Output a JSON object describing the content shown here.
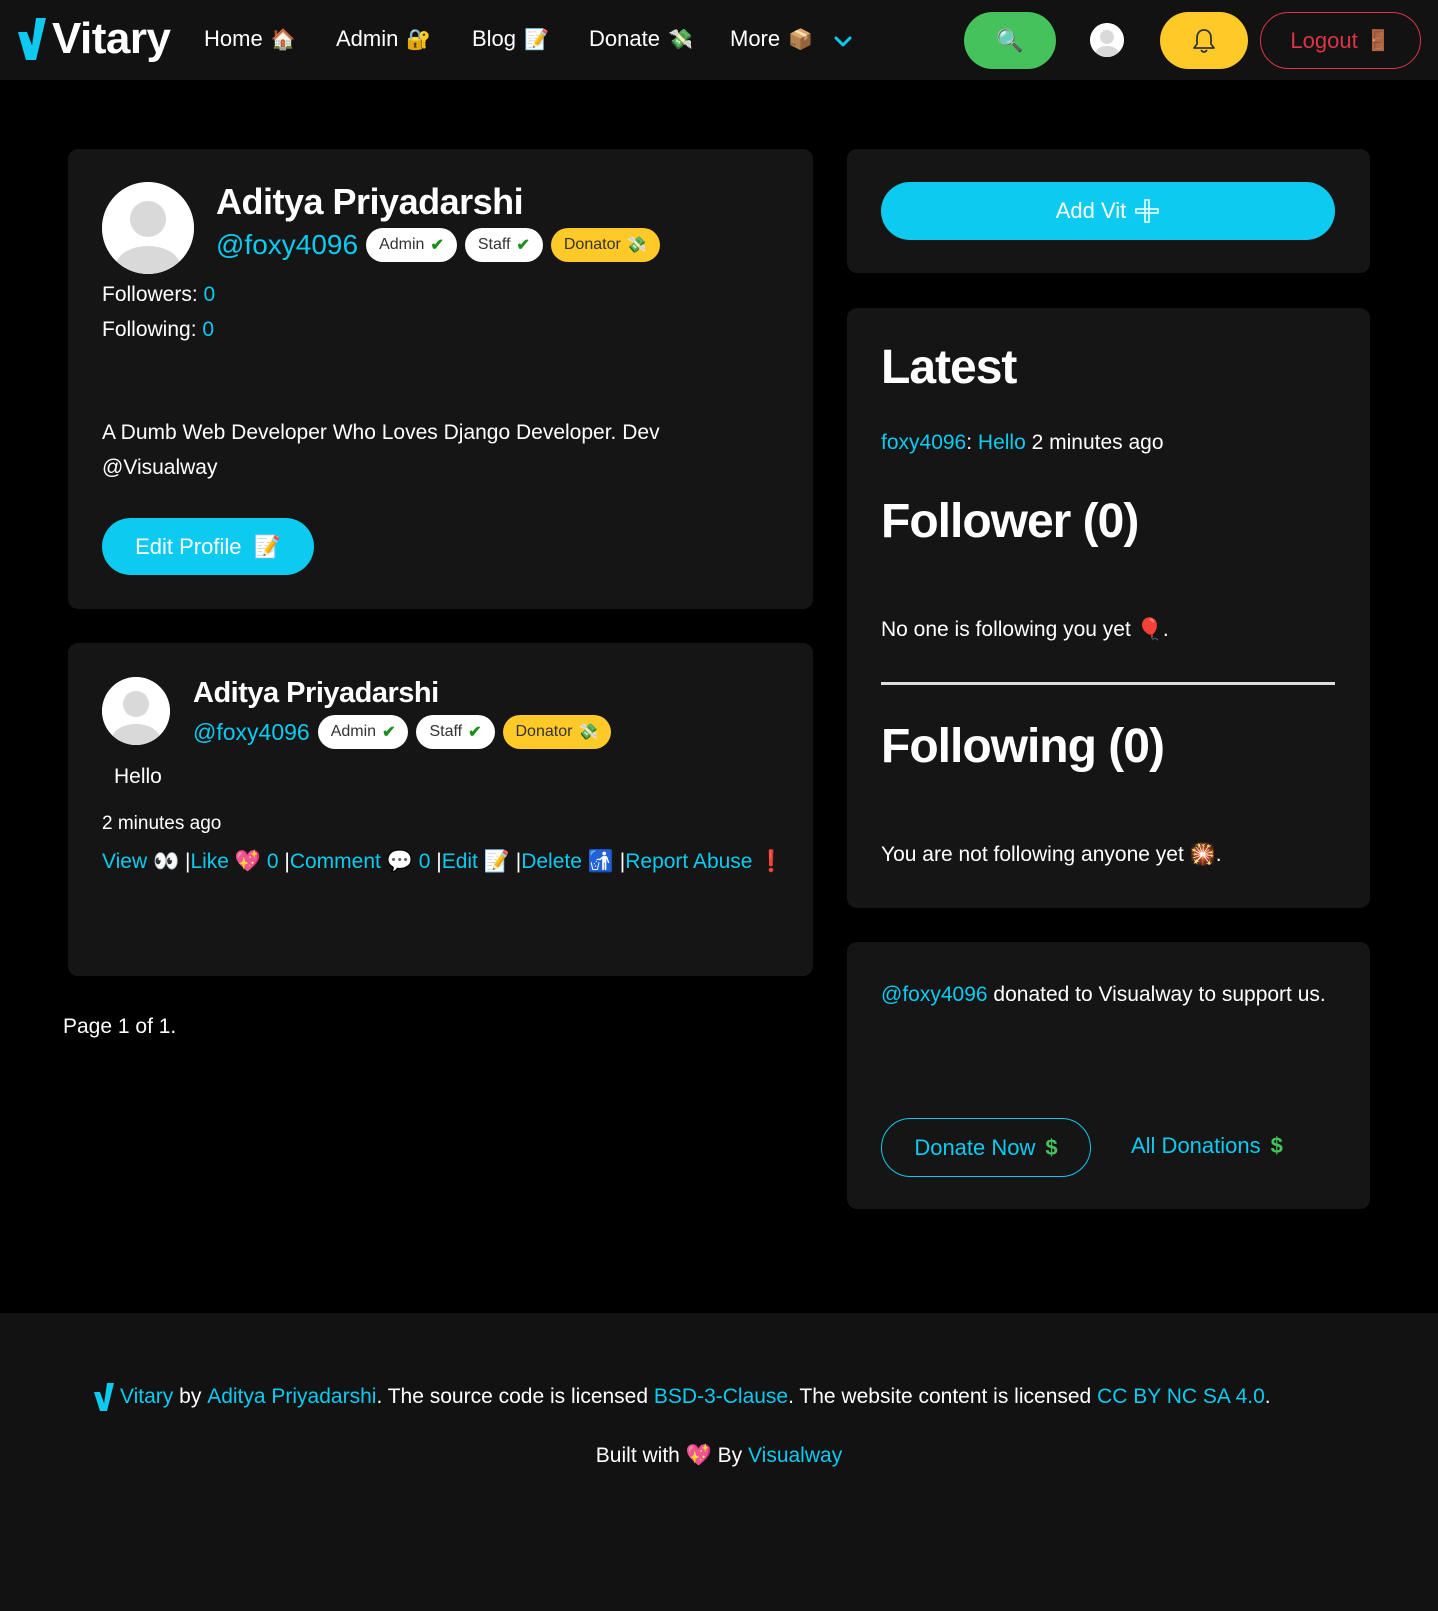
{
  "navbar": {
    "brand": "Vitary",
    "items": [
      {
        "label": "Home",
        "emoji": "🏠"
      },
      {
        "label": "Admin",
        "emoji": "🔐"
      },
      {
        "label": "Blog",
        "emoji": "📝"
      },
      {
        "label": "Donate",
        "emoji": "💸"
      },
      {
        "label": "More",
        "emoji": "📦"
      }
    ],
    "search_emoji": "🔍",
    "logout_label": "Logout",
    "logout_emoji": "🚪"
  },
  "profile": {
    "name": "Aditya Priyadarshi",
    "handle": "@foxy4096",
    "badges": {
      "admin": "Admin",
      "staff": "Staff",
      "donator": "Donator",
      "check": "✔",
      "donator_emoji": "💸"
    },
    "followers_label": "Followers:",
    "followers_count": "0",
    "following_label": "Following:",
    "following_count": "0",
    "bio_line1": "A Dumb Web Developer Who Loves Django Developer. Dev",
    "bio_line2": "@Visualway",
    "edit_label": "Edit Profile",
    "edit_emoji": "📝"
  },
  "post": {
    "name": "Aditya Priyadarshi",
    "handle": "@foxy4096",
    "content": "Hello",
    "time": "2 minutes ago",
    "actions": {
      "view": "View",
      "view_emoji": "👀",
      "like": "Like",
      "like_emoji": "💖",
      "like_count": "0",
      "comment": "Comment",
      "comment_emoji": "💬",
      "comment_count": "0",
      "edit": "Edit",
      "edit_emoji": "📝",
      "delete": "Delete",
      "delete_emoji": "🚮",
      "report": "Report",
      "abuse": "Abuse",
      "report_emoji": "❗",
      "sep": "|"
    }
  },
  "pagination": "Page 1 of 1.",
  "sidebar": {
    "add_vit": "Add Vit",
    "latest_title": "Latest",
    "latest_user": "foxy4096",
    "latest_colon": ":",
    "latest_text": "Hello",
    "latest_time": "2 minutes ago",
    "follower_title": "Follower (0)",
    "no_follower": "No one is following you yet",
    "no_follower_emoji": "🎈",
    "following_title": "Following (0)",
    "no_following": "You are not following anyone yet",
    "no_following_emoji": "🎇",
    "period": ".",
    "donation_user": "@foxy4096",
    "donation_text": "donated to Visualway to support",
    "donation_text2": "us.",
    "donate_now": "Donate Now",
    "all_donations": "All Donations",
    "dollar": "$"
  },
  "footer": {
    "brand": "Vitary",
    "by": "by",
    "author": "Aditya Priyadarshi",
    "text1": ". The source code is licensed",
    "license1": "BSD-3-Clause",
    "text2": ". The website content is licensed",
    "license2": "CC BY NC SA 4.0",
    "end": ".",
    "built_with": "Built with",
    "heart": "💖",
    "by2": "By",
    "org": "Visualway"
  },
  "colors": {
    "accent": "#0dcaf0",
    "search": "#45c25b",
    "warning": "#ffc928",
    "danger": "#dc3545",
    "card": "#151515"
  }
}
